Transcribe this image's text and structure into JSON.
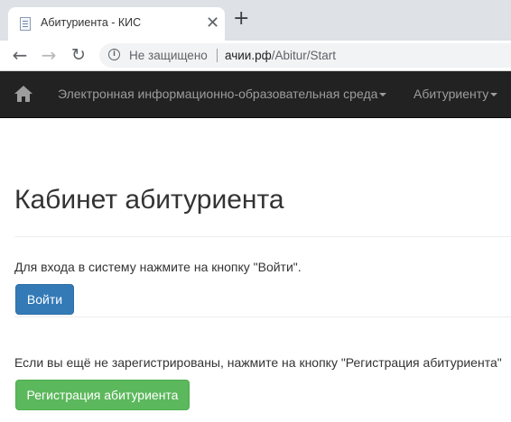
{
  "browser": {
    "tab": {
      "title": "Абитуриента - КИС",
      "close_glyph": "✕"
    },
    "new_tab_glyph": "+",
    "nav": {
      "back_glyph": "←",
      "forward_glyph": "→",
      "reload_glyph": "↻"
    },
    "omnibox": {
      "info_glyph": "i",
      "security_text": "Не защищено",
      "url_host": "ачии.рф",
      "url_path": "/Abitur/Start"
    }
  },
  "navbar": {
    "home_icon": "home-icon",
    "items": [
      {
        "label": "Электронная информационно-образовательная среда"
      },
      {
        "label": "Абитуриенту"
      }
    ]
  },
  "main": {
    "title": "Кабинет абитуриента",
    "login_prompt": "Для входа в систему нажмите на кнопку \"Войти\".",
    "login_button": "Войти",
    "register_prompt": "Если вы ещё не зарегистрированы, нажмите на кнопку \"Регистрация абитуриента\"",
    "register_button": "Регистрация абитуриента"
  },
  "colors": {
    "navbar_bg": "#222222",
    "navbar_text": "#9d9d9d",
    "primary": "#337ab7",
    "success": "#5cb85c"
  }
}
